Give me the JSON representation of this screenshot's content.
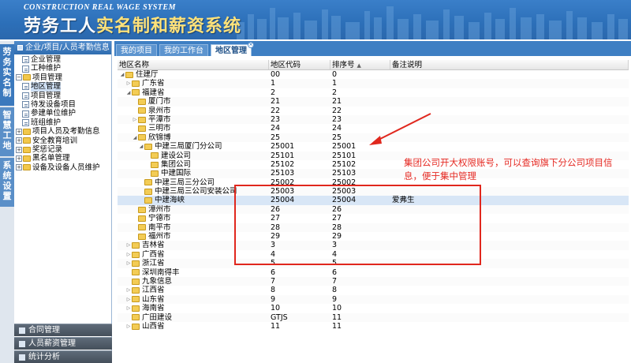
{
  "header": {
    "brand_en": "CONSTRUCTION REAL WAGE SYSTEM",
    "brand_cn_a": "劳务工人",
    "brand_cn_b": "实名制和薪资系统"
  },
  "vertical_menu": [
    {
      "label": "劳务实名制"
    },
    {
      "label": "智慧工地"
    },
    {
      "label": "系统设置"
    }
  ],
  "left_panel": {
    "title": "企业/项目/人员考勤信息",
    "tree": [
      {
        "label": "企业管理",
        "level": 1,
        "kind": "page"
      },
      {
        "label": "工种维护",
        "level": 1,
        "kind": "page"
      },
      {
        "label": "项目管理",
        "level": 0,
        "kind": "folder",
        "toggle": "−"
      },
      {
        "label": "地区管理",
        "level": 1,
        "kind": "page",
        "selected": true
      },
      {
        "label": "项目管理",
        "level": 1,
        "kind": "page"
      },
      {
        "label": "待发设备项目",
        "level": 1,
        "kind": "page"
      },
      {
        "label": "参建单位维护",
        "level": 1,
        "kind": "page"
      },
      {
        "label": "班组维护",
        "level": 1,
        "kind": "page"
      },
      {
        "label": "项目人员及考勤信息",
        "level": 0,
        "kind": "folder",
        "toggle": "+"
      },
      {
        "label": "安全教育培训",
        "level": 0,
        "kind": "folder",
        "toggle": "+"
      },
      {
        "label": "奖惩记录",
        "level": 0,
        "kind": "folder",
        "toggle": "+"
      },
      {
        "label": "黑名单管理",
        "level": 0,
        "kind": "folder",
        "toggle": "+"
      },
      {
        "label": "设备及设备人员维护",
        "level": 0,
        "kind": "folder",
        "toggle": "+"
      }
    ],
    "bottom_menu": [
      {
        "label": "合同管理"
      },
      {
        "label": "人员薪资管理"
      },
      {
        "label": "统计分析"
      }
    ]
  },
  "tabs": [
    {
      "label": "我的项目",
      "active": false
    },
    {
      "label": "我的工作台",
      "active": false
    },
    {
      "label": "地区管理",
      "active": true
    }
  ],
  "annotation": {
    "text": "集团公司开大权限账号，可以查询旗下分公司项目信息，便于集中管理",
    "color": "#e52a23"
  },
  "chart_data": {
    "type": "table",
    "columns": [
      "地区名称",
      "地区代码",
      "排序号",
      "备注说明"
    ],
    "rows": [
      {
        "name": "住建厅",
        "code": "00",
        "order": "0",
        "note": "",
        "depth": 0,
        "expand": "open"
      },
      {
        "name": "广东省",
        "code": "1",
        "order": "1",
        "note": "",
        "depth": 1,
        "expand": "closed"
      },
      {
        "name": "福建省",
        "code": "2",
        "order": "2",
        "note": "",
        "depth": 1,
        "expand": "open"
      },
      {
        "name": "厦门市",
        "code": "21",
        "order": "21",
        "note": "",
        "depth": 2,
        "expand": "none"
      },
      {
        "name": "泉州市",
        "code": "22",
        "order": "22",
        "note": "",
        "depth": 2,
        "expand": "none"
      },
      {
        "name": "平潭市",
        "code": "23",
        "order": "23",
        "note": "",
        "depth": 2,
        "expand": "closed"
      },
      {
        "name": "三明市",
        "code": "24",
        "order": "24",
        "note": "",
        "depth": 2,
        "expand": "none"
      },
      {
        "name": "欣锦博",
        "code": "25",
        "order": "25",
        "note": "",
        "depth": 2,
        "expand": "open"
      },
      {
        "name": "中建三局厦门分公司",
        "code": "25001",
        "order": "25001",
        "note": "",
        "depth": 3,
        "expand": "open"
      },
      {
        "name": "建设公司",
        "code": "25101",
        "order": "25101",
        "note": "",
        "depth": 4,
        "expand": "none"
      },
      {
        "name": "集团公司",
        "code": "25102",
        "order": "25102",
        "note": "",
        "depth": 4,
        "expand": "none"
      },
      {
        "name": "中建国际",
        "code": "25103",
        "order": "25103",
        "note": "",
        "depth": 4,
        "expand": "none"
      },
      {
        "name": "中建三局三分公司",
        "code": "25002",
        "order": "25002",
        "note": "",
        "depth": 3,
        "expand": "none"
      },
      {
        "name": "中建三局三公司安装公司",
        "code": "25003",
        "order": "25003",
        "note": "",
        "depth": 3,
        "expand": "none"
      },
      {
        "name": "中建海峡",
        "code": "25004",
        "order": "25004",
        "note": "爱弗生",
        "depth": 3,
        "expand": "none",
        "highlight": true
      },
      {
        "name": "漳州市",
        "code": "26",
        "order": "26",
        "note": "",
        "depth": 2,
        "expand": "none"
      },
      {
        "name": "宁德市",
        "code": "27",
        "order": "27",
        "note": "",
        "depth": 2,
        "expand": "none"
      },
      {
        "name": "南平市",
        "code": "28",
        "order": "28",
        "note": "",
        "depth": 2,
        "expand": "none"
      },
      {
        "name": "福州市",
        "code": "29",
        "order": "29",
        "note": "",
        "depth": 2,
        "expand": "none"
      },
      {
        "name": "吉林省",
        "code": "3",
        "order": "3",
        "note": "",
        "depth": 1,
        "expand": "closed"
      },
      {
        "name": "广西省",
        "code": "4",
        "order": "4",
        "note": "",
        "depth": 1,
        "expand": "closed"
      },
      {
        "name": "浙江省",
        "code": "5",
        "order": "5",
        "note": "",
        "depth": 1,
        "expand": "closed"
      },
      {
        "name": "深圳南得丰",
        "code": "6",
        "order": "6",
        "note": "",
        "depth": 1,
        "expand": "none"
      },
      {
        "name": "九象信息",
        "code": "7",
        "order": "7",
        "note": "",
        "depth": 1,
        "expand": "none"
      },
      {
        "name": "江西省",
        "code": "8",
        "order": "8",
        "note": "",
        "depth": 1,
        "expand": "closed"
      },
      {
        "name": "山东省",
        "code": "9",
        "order": "9",
        "note": "",
        "depth": 1,
        "expand": "closed"
      },
      {
        "name": "海南省",
        "code": "10",
        "order": "10",
        "note": "",
        "depth": 1,
        "expand": "closed"
      },
      {
        "name": "广田建设",
        "code": "GTJS",
        "order": "11",
        "note": "",
        "depth": 1,
        "expand": "none"
      },
      {
        "name": "山西省",
        "code": "11",
        "order": "11",
        "note": "",
        "depth": 1,
        "expand": "closed"
      }
    ]
  }
}
